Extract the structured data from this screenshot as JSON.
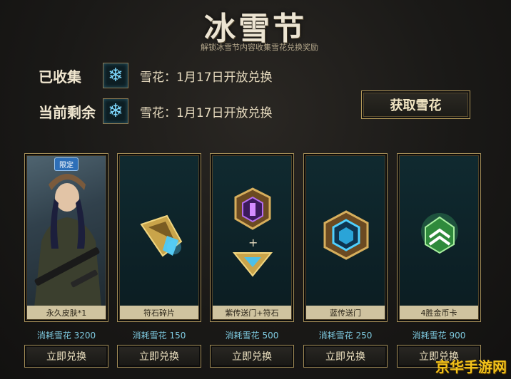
{
  "header": {
    "title": "冰雪节",
    "subtitle": "解锁冰雪节内容收集雪花兑换奖励"
  },
  "collected": {
    "label": "已收集",
    "icon": "snowflake-icon",
    "value": "雪花：1月17日开放兑换"
  },
  "remaining": {
    "label": "当前剩余",
    "icon": "snowflake-icon",
    "value": "雪花：1月17日开放兑换"
  },
  "get_button": "获取雪花",
  "cards": [
    {
      "name": "永久皮肤*1",
      "cost": "消耗雪花 3200",
      "button": "立即兑换",
      "badge": "限定",
      "icon": "skin-portrait"
    },
    {
      "name": "符石碎片",
      "cost": "消耗雪花 150",
      "button": "立即兑换",
      "icon": "rune-shard-icon"
    },
    {
      "name": "紫传送门+符石",
      "cost": "消耗雪花 500",
      "button": "立即兑换",
      "plus": "+",
      "icon": "purple-portal-icon"
    },
    {
      "name": "蓝传送门",
      "cost": "消耗雪花 250",
      "button": "立即兑换",
      "icon": "blue-portal-icon"
    },
    {
      "name": "4胜金币卡",
      "cost": "消耗雪花 900",
      "button": "立即兑换",
      "icon": "gold-card-icon"
    }
  ],
  "watermark": "京华手游网",
  "colors": {
    "gold": "#a38d57",
    "cyan": "#7ecae0",
    "panel": "#0b1c21"
  }
}
